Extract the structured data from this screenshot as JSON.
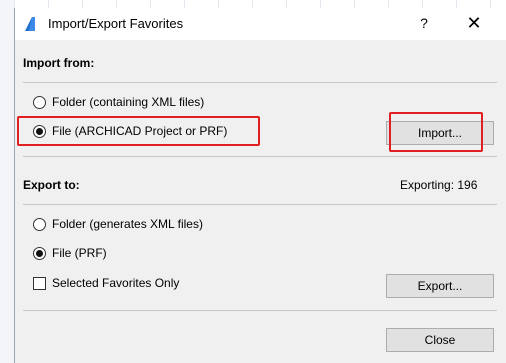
{
  "window": {
    "title": "Import/Export Favorites",
    "help_label": "?",
    "close_label": "✕"
  },
  "import": {
    "section_label": "Import from:",
    "options": [
      {
        "label": "Folder (containing XML files)",
        "selected": false
      },
      {
        "label": "File (ARCHICAD Project or PRF)",
        "selected": true
      }
    ],
    "button_label": "Import..."
  },
  "export": {
    "section_label": "Export to:",
    "status": "Exporting: 196",
    "options": [
      {
        "label": "Folder (generates XML files)",
        "selected": false
      },
      {
        "label": "File (PRF)",
        "selected": true
      }
    ],
    "selected_only_label": "Selected Favorites Only",
    "selected_only_checked": false,
    "button_label": "Export..."
  },
  "footer": {
    "close_label": "Close"
  },
  "colors": {
    "highlight": "#e02020",
    "dialog_bg": "#f0f0f0",
    "button_bg": "#e1e1e1"
  }
}
